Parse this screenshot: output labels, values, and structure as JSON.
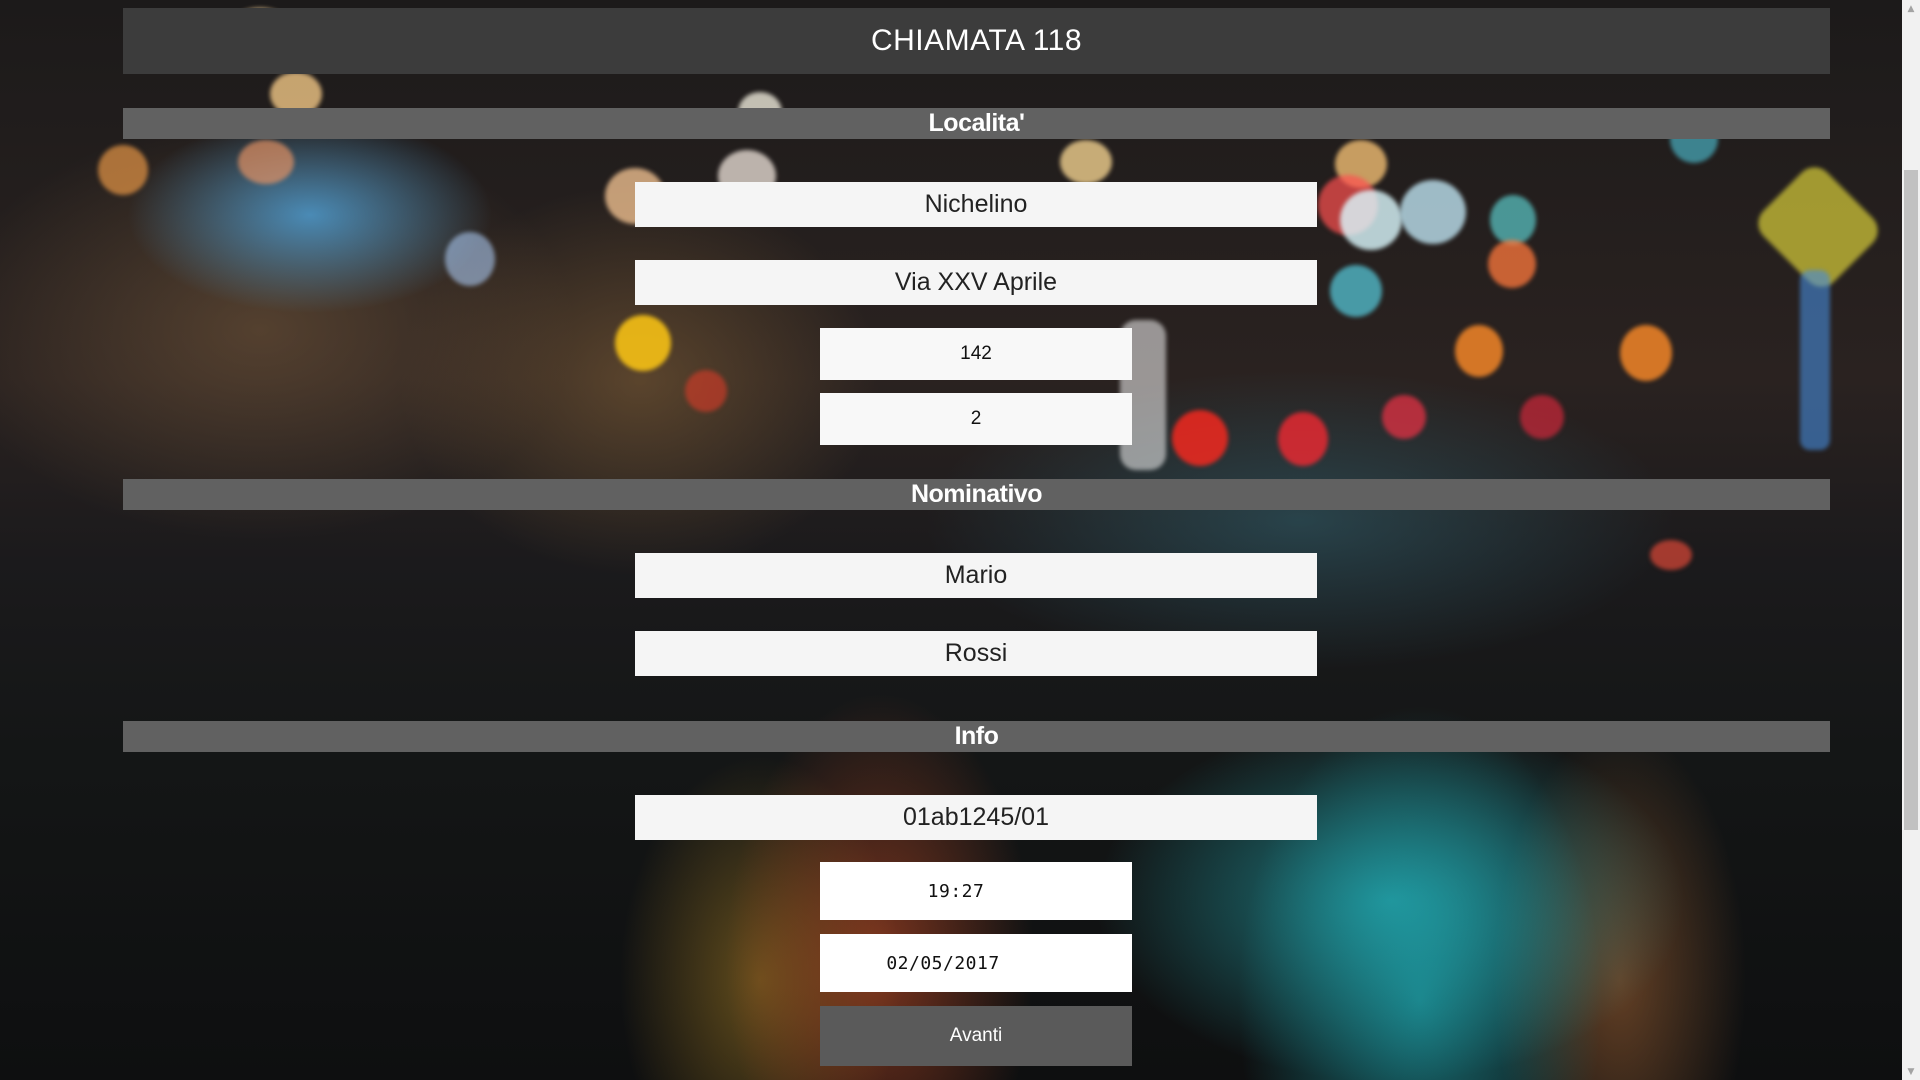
{
  "header": {
    "title": "CHIAMATA 118"
  },
  "sections": {
    "localita": {
      "title": "Localita'",
      "city": "Nichelino",
      "street": "Via XXV Aprile",
      "civic_number": "142",
      "floor": "2"
    },
    "nominativo": {
      "title": "Nominativo",
      "first_name": "Mario",
      "last_name": "Rossi"
    },
    "info": {
      "title": "Info",
      "code": "01ab1245/01",
      "time": "19:27",
      "date": "02/05/2017"
    }
  },
  "actions": {
    "next_label": "Avanti"
  },
  "colors": {
    "header_bg": "#3c3c3c",
    "section_bg": "#616161",
    "button_bg": "#5a5a5a",
    "field_bg": "#f5f5f5"
  }
}
